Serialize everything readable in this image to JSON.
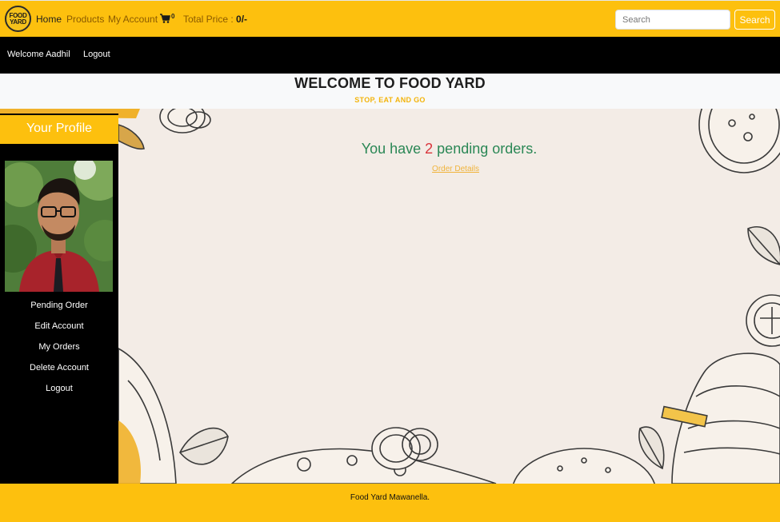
{
  "navbar": {
    "logo_line1": "FOOD",
    "logo_line2": "YARD",
    "links": {
      "home": "Home",
      "products": "Products",
      "account": "My Account"
    },
    "cart_count": "0",
    "total_label": "Total Price : ",
    "total_value": "0/-",
    "search_placeholder": "Search",
    "search_button": "Search"
  },
  "userbar": {
    "welcome": "Welcome Aadhil",
    "logout": "Logout"
  },
  "header": {
    "title": "WELCOME TO FOOD YARD",
    "tagline": "STOP, EAT AND GO"
  },
  "sidebar": {
    "title": "Your Profile",
    "items": [
      "Pending Order",
      "Edit Account",
      "My Orders",
      "Delete Account",
      "Logout"
    ]
  },
  "content": {
    "pending_prefix": "You have ",
    "pending_count": "2",
    "pending_suffix": " pending orders.",
    "order_details": "Order Details"
  },
  "footer": {
    "text": "Food Yard Mawanella."
  },
  "colors": {
    "brand_yellow": "#fdc00e",
    "green_text": "#2a8755",
    "red_count": "#d9343b"
  }
}
